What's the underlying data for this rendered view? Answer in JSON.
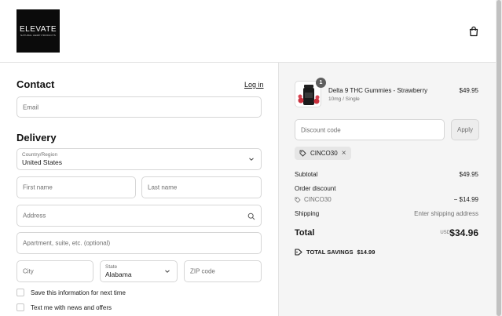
{
  "header": {
    "logo_text": "ELEVATE",
    "logo_subtext": "NATURAL HEMP PRODUCTS",
    "cart_icon": "shopping-bag-icon"
  },
  "contact": {
    "title": "Contact",
    "login_link": "Log in",
    "email_placeholder": "Email"
  },
  "delivery": {
    "title": "Delivery",
    "country_label": "Country/Region",
    "country_value": "United States",
    "first_name_placeholder": "First name",
    "last_name_placeholder": "Last name",
    "address_placeholder": "Address",
    "apartment_placeholder": "Apartment, suite, etc. (optional)",
    "city_placeholder": "City",
    "state_label": "State",
    "state_value": "Alabama",
    "zip_placeholder": "ZIP code",
    "save_info_label": "Save this information for next time",
    "text_me_label": "Text me with news and offers"
  },
  "summary": {
    "product": {
      "quantity": "1",
      "name": "Delta 9 THC Gummies - Strawberry",
      "variant": "10mg / Single",
      "price": "$49.95"
    },
    "discount_placeholder": "Discount code",
    "apply_label": "Apply",
    "applied_code": "CINCO30",
    "subtotal_label": "Subtotal",
    "subtotal_value": "$49.95",
    "order_discount_label": "Order discount",
    "order_discount_code": "CINCO30",
    "order_discount_value": "− $14.99",
    "shipping_label": "Shipping",
    "shipping_value": "Enter shipping address",
    "total_label": "Total",
    "total_currency": "USD",
    "total_value": "$34.96",
    "savings_label": "TOTAL SAVINGS",
    "savings_value": "$14.99"
  },
  "colors": {
    "text": "#1a1a1a",
    "muted": "#707070",
    "border": "#d6d6d6",
    "summary_bg": "#f5f5f5"
  }
}
